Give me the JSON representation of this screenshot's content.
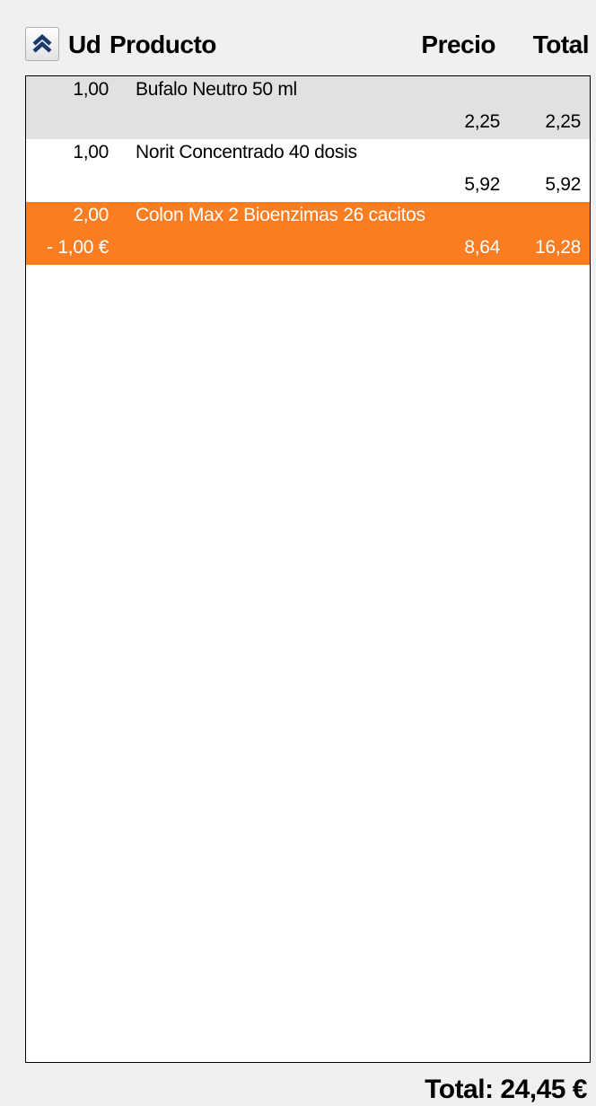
{
  "header": {
    "collapse_icon": "double-chevron-up-icon",
    "ud_label": "Ud",
    "producto_label": "Producto",
    "precio_label": "Precio",
    "total_label": "Total"
  },
  "items": [
    {
      "qty": "1,00",
      "name": "Bufalo Neutro 50 ml",
      "discount": "",
      "price": "2,25",
      "total": "2,25",
      "selected": false
    },
    {
      "qty": "1,00",
      "name": "Norit Concentrado 40 dosis",
      "discount": "",
      "price": "5,92",
      "total": "5,92",
      "selected": false
    },
    {
      "qty": "2,00",
      "name": "Colon Max 2 Bioenzimas 26 cacitos",
      "discount": "- 1,00 €",
      "price": "8,64",
      "total": "16,28",
      "selected": true
    }
  ],
  "footer": {
    "total_text": "Total: 24,45 €"
  },
  "colors": {
    "selected_row": "#fb7d22",
    "alt_row": "#e1e1e1",
    "icon": "#1a3a6e"
  }
}
